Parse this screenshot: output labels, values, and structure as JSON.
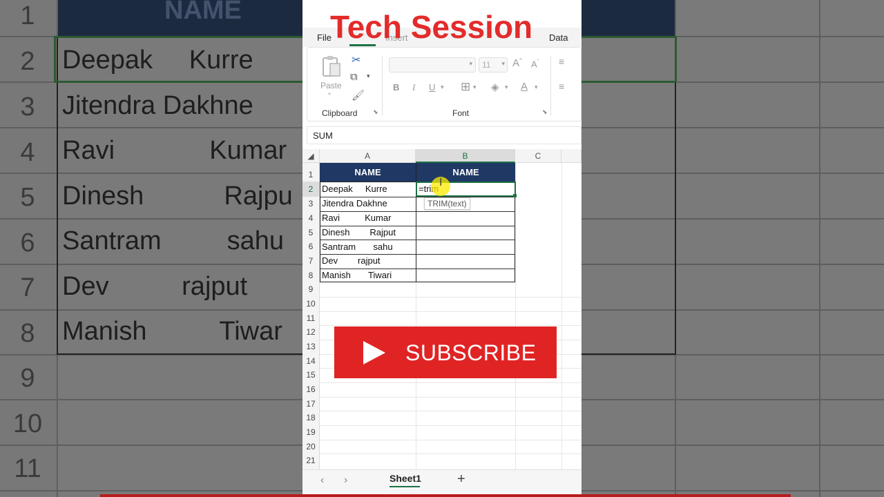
{
  "overlay": {
    "title": "Tech Session",
    "subscribe_label": "SUBSCRIBE"
  },
  "background": {
    "header": "NAME",
    "row_numbers": [
      "1",
      "2",
      "3",
      "4",
      "5",
      "6",
      "7",
      "8",
      "9",
      "10",
      "11"
    ],
    "names": [
      "Deepak     Kurre",
      "Jitendra Dakhne",
      "Ravi             Kumar",
      "Dinesh           Rajpu",
      "Santram         sahu",
      "Dev          rajput",
      "Manish          Tiwar"
    ]
  },
  "ribbon": {
    "tabs": [
      "File",
      "Insert",
      "Data"
    ],
    "paste_label": "Paste",
    "clipboard_label": "Clipboard",
    "font_label": "Font",
    "font_size": "11",
    "bold": "B",
    "italic": "I",
    "underline": "U"
  },
  "formula_bar": {
    "name_box": "SUM"
  },
  "sheet": {
    "columns": [
      "A",
      "B",
      "C"
    ],
    "rows": [
      "1",
      "2",
      "3",
      "4",
      "5",
      "6",
      "7",
      "8",
      "9",
      "10",
      "11",
      "12",
      "13",
      "14",
      "15",
      "16",
      "17",
      "18",
      "19",
      "20",
      "21"
    ],
    "header_a": "NAME",
    "header_b": "NAME",
    "names": [
      "Deepak     Kurre",
      "Jitendra Dakhne",
      "Ravi          Kumar",
      "Dinesh        Rajput",
      "Santram       sahu",
      "Dev        rajput",
      "Manish       Tiwari"
    ],
    "active_input": "=trim",
    "tooltip": "TRIM(text)",
    "sheet_tab": "Sheet1",
    "add_sheet": "+"
  },
  "colors": {
    "header_fill": "#1f3864",
    "accent_green": "#1e7145",
    "title_red": "#e32b2b",
    "subscribe_red": "#e02424"
  }
}
